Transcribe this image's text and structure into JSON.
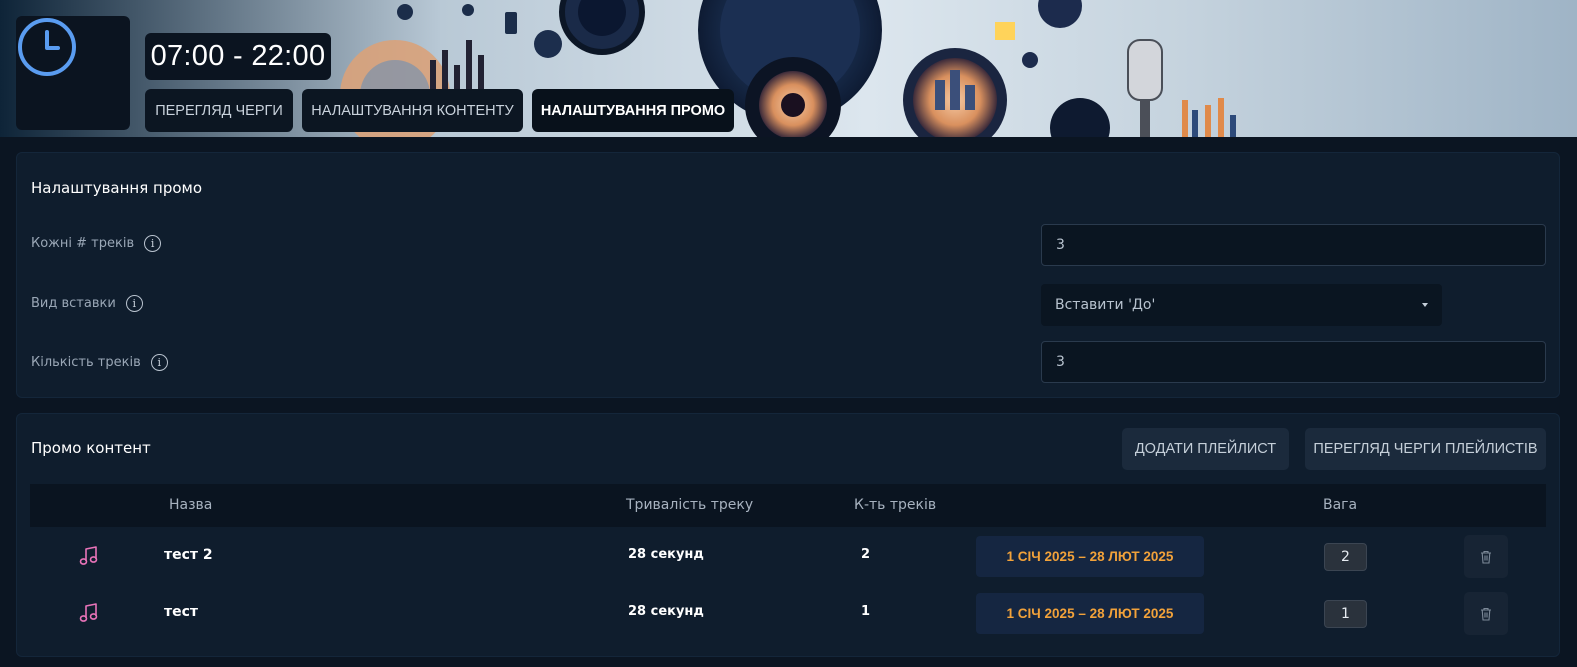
{
  "header": {
    "time_range": "07:00 - 22:00",
    "nav": [
      {
        "label": "Перегляд черги",
        "active": false
      },
      {
        "label": "Налаштування контенту",
        "active": false
      },
      {
        "label": "Налаштування промо",
        "active": true
      }
    ],
    "accent_color": "#5a9cf0"
  },
  "promo_settings": {
    "title": "Налаштування промо",
    "fields": [
      {
        "label": "Кожні # треків",
        "value": "3",
        "type": "input"
      },
      {
        "label": "Вид вставки",
        "value": "Вставити 'До'",
        "type": "select"
      },
      {
        "label": "Кількість треків",
        "value": "3",
        "type": "input"
      }
    ]
  },
  "promo_content": {
    "title": "Промо контент",
    "add_button": "Додати плейлист",
    "queue_button": "Перегляд черги плейлистів",
    "columns": [
      "Назва",
      "Тривалість треку",
      "К-ть треків",
      "Вага"
    ],
    "rows": [
      {
        "name": "тест 2",
        "duration": "28 секунд",
        "count": "2",
        "dates": "1 СІЧ 2025 – 28 ЛЮТ 2025",
        "weight": "2"
      },
      {
        "name": "тест",
        "duration": "28 секунд",
        "count": "1",
        "dates": "1 СІЧ 2025 – 28 ЛЮТ 2025",
        "weight": "1"
      }
    ],
    "icon_color": "#e873b8",
    "date_color": "#f2a23a"
  }
}
